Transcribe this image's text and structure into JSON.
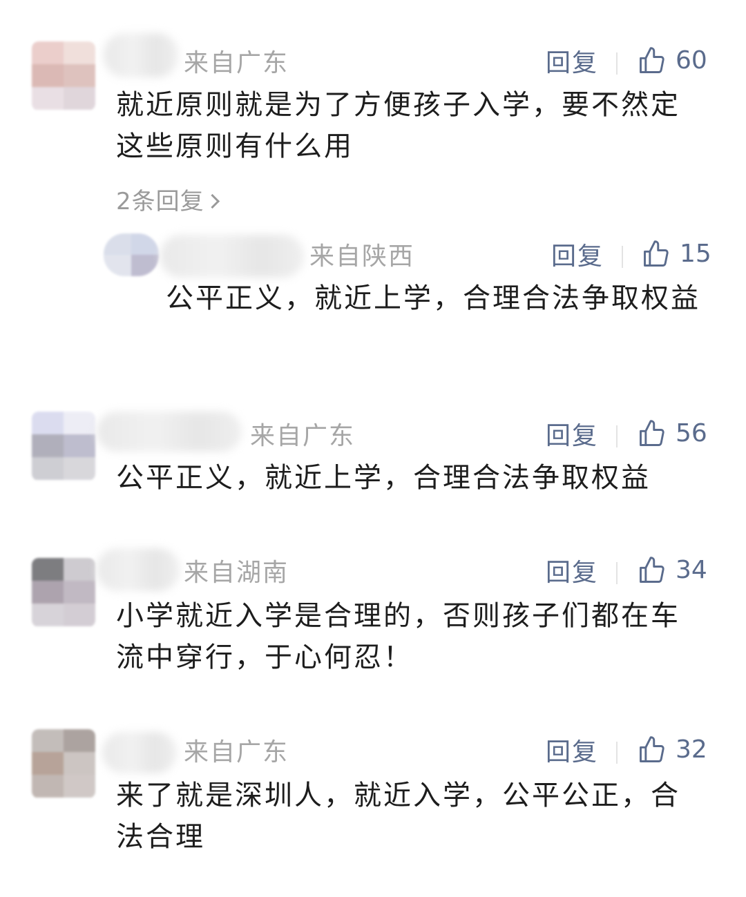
{
  "comments": [
    {
      "location": "来自广东",
      "reply_label": "回复",
      "likes": "60",
      "text": "就近原则就是为了方便孩子入学，要不然定这些原则有什么用",
      "more_replies": "2条回复",
      "replies": [
        {
          "location": "来自陕西",
          "reply_label": "回复",
          "likes": "15",
          "text": "公平正义，就近上学，合理合法争取权益"
        }
      ]
    },
    {
      "location": "来自广东",
      "reply_label": "回复",
      "likes": "56",
      "text": "公平正义，就近上学，合理合法争取权益"
    },
    {
      "location": "来自湖南",
      "reply_label": "回复",
      "likes": "34",
      "text": "小学就近入学是合理的，否则孩子们都在车流中穿行，于心何忍！"
    },
    {
      "location": "来自广东",
      "reply_label": "回复",
      "likes": "32",
      "text": "来了就是深圳人，就近入学，公平公正，合法合理"
    }
  ],
  "icons": {
    "like": "thumbs-up-icon",
    "more": "chevron-right-icon"
  },
  "colors": {
    "link": "#5a6b8c",
    "meta": "#a6a6a6",
    "text": "#1d1d1d"
  }
}
